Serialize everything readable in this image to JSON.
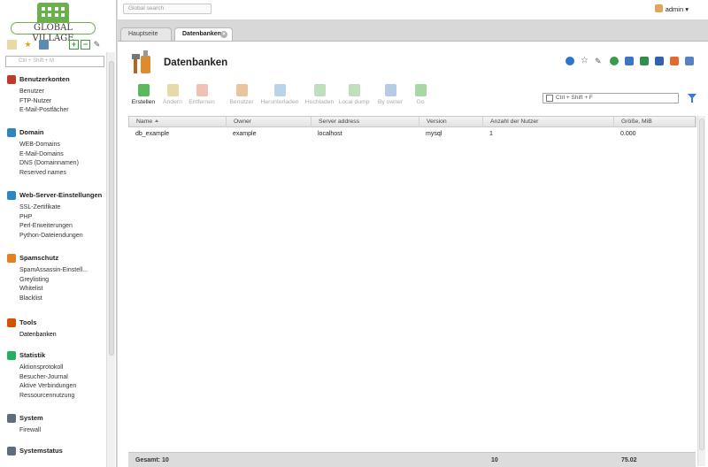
{
  "brand": {
    "logo_text": "GLOBAL VILLAGE"
  },
  "sidebar": {
    "search_placeholder": "Ctrl + Shift + M",
    "sections": [
      {
        "title": "Benutzerkonten",
        "icon": "users-icon",
        "color": "#c0392b",
        "items": [
          "Benutzer",
          "FTP-Nutzer",
          "E-Mail-Postfächer"
        ]
      },
      {
        "title": "Domain",
        "icon": "globe-icon",
        "color": "#2e86c1",
        "items": [
          "WEB-Domains",
          "E-Mail-Domains",
          "DNS (Domainnamen)",
          "Reserved names"
        ]
      },
      {
        "title": "Web-Server-Einstellungen",
        "icon": "server-globe-icon",
        "color": "#2e86c1",
        "items": [
          "SSL-Zertifikate",
          "PHP",
          "Perl-Erweiterungen",
          "Python-Dateiendungen"
        ]
      },
      {
        "title": "Spamschutz",
        "icon": "shield-icon",
        "color": "#e67e22",
        "items": [
          "SpamAssassin-Einstell...",
          "Greylisting",
          "Whitelist",
          "Blacklist"
        ]
      },
      {
        "title": "Tools",
        "icon": "tools-icon",
        "color": "#d35400",
        "items": [
          "Datenbanken"
        ]
      },
      {
        "title": "Statistik",
        "icon": "chart-icon",
        "color": "#27ae60",
        "items": [
          "Aktionsprotokoll",
          "Besucher-Journal",
          "Aktive Verbindungen",
          "Ressourcennutzung"
        ]
      },
      {
        "title": "System",
        "icon": "system-icon",
        "color": "#5d6d7e",
        "items": [
          "Firewall"
        ]
      },
      {
        "title": "Systemstatus",
        "icon": "status-icon",
        "color": "#5d6d7e",
        "items": []
      }
    ],
    "active_item": "Datenbanken"
  },
  "topbar": {
    "search_placeholder": "Global search",
    "user": "admin"
  },
  "tabs": [
    {
      "label": "Hauptseite",
      "active": false
    },
    {
      "label": "Datenbanken",
      "active": true
    }
  ],
  "page": {
    "title": "Datenbanken",
    "toolbar": [
      {
        "label": "Erstellen",
        "enabled": true,
        "icon": "create-icon",
        "color": "#5cb85c"
      },
      {
        "label": "Ändern",
        "enabled": false,
        "icon": "edit-icon",
        "color": "#e8d9a8"
      },
      {
        "label": "Entfernen",
        "enabled": false,
        "icon": "delete-icon",
        "color": "#f0c2b5"
      },
      {
        "label": "Benutzer",
        "enabled": false,
        "icon": "user-icon",
        "color": "#e9c59e"
      },
      {
        "label": "Herunterladen",
        "enabled": false,
        "icon": "download-icon",
        "color": "#b9d3ea"
      },
      {
        "label": "Hochladen",
        "enabled": false,
        "icon": "upload-icon",
        "color": "#bfe0bd"
      },
      {
        "label": "Local dump",
        "enabled": false,
        "icon": "dump-icon",
        "color": "#bfe0bd"
      },
      {
        "label": "By owner",
        "enabled": false,
        "icon": "filter-owner-icon",
        "color": "#b5cbe8"
      },
      {
        "label": "Go",
        "enabled": false,
        "icon": "go-icon",
        "color": "#a7d8a2"
      }
    ],
    "filter_placeholder": "Ctrl + Shift + F"
  },
  "table": {
    "columns": [
      "Name",
      "Owner",
      "Server address",
      "Version",
      "Anzahl der Nutzer",
      "Größe, MiB"
    ],
    "rows": [
      [
        "db_example",
        "example",
        "localhost",
        "mysql",
        "1",
        "0.000"
      ]
    ],
    "totals": {
      "label": "Gesamt: 10",
      "users": "10",
      "size": "75.02"
    }
  }
}
